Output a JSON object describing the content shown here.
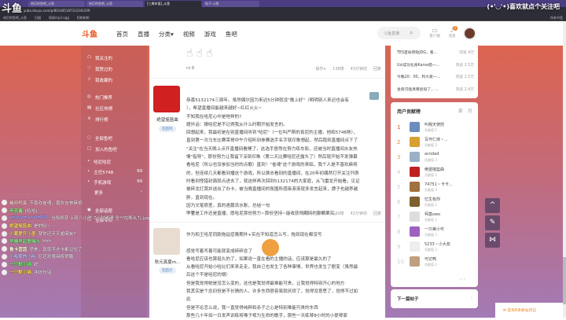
{
  "overlay": {
    "logo": "斗鱼",
    "follow": "(•'◡'•)喜欢就点个关注吧"
  },
  "browser": {
    "tabs": [
      "哈尼的鱼吧_斗鱼",
      "哈尼的鱼吧_斗鱼",
      "[三周年饭]_斗鱼",
      "帖子-斗鱼"
    ],
    "url": "yuba.douyu.com/p/801485187312341209",
    "bookmarks": [
      "哈尼的鱼吧_斗鱼",
      "扫描",
      "网易mp3 ogg",
      "阿帕帕帕"
    ],
    "bookmark_right": "所有书签"
  },
  "header": {
    "brand": "斗鱼",
    "nav": [
      "首页",
      "直播",
      "分类▾",
      "视频",
      "游戏",
      "鱼吧"
    ],
    "search_placeholder": "斗鱼直播",
    "client": "客户端",
    "messages": "消息",
    "message_count": "1",
    "icon_client": "client-icon",
    "icon_message": "bell-icon"
  },
  "sidebar": {
    "items": [
      {
        "label": "我关注的",
        "icon": "☖"
      },
      {
        "label": "我赞过的",
        "icon": "♡"
      },
      {
        "label": "我收藏的",
        "icon": "☆"
      },
      {
        "label": "热门推荐",
        "icon": "◎"
      },
      {
        "label": "社区热榜",
        "icon": "▤"
      },
      {
        "label": "排行榜",
        "icon": "♕"
      },
      {
        "label": "全部鱼吧",
        "icon": "◌"
      },
      {
        "label": "加入的鱼吧",
        "icon": "▢"
      }
    ],
    "groups": [
      {
        "label": "哈尼哈尼",
        "count": ""
      },
      {
        "label": "主任5748",
        "count": "99"
      },
      {
        "label": "手机游戏",
        "count": "99"
      }
    ],
    "more": "更多",
    "extra": [
      {
        "label": "全部话题",
        "icon": "◉"
      },
      {
        "label": "全部专栏",
        "icon": "▢"
      }
    ]
  },
  "posts": [
    {
      "likes": "0",
      "actions": "操作∨",
      "floor": "138楼",
      "time": "43分钟前",
      "reply": "回复"
    },
    {
      "name": "绝望摇篮曲",
      "badge": "犯困鸡",
      "lines": [
        "恭喜5132174三周年。虽然偶尔因为来迟5分钟就没\"晚上好\"（明明别人来迟也会有",
        "），希望直播间能越来越好~红红火火~",
        "不知我在哈尼心中是啥样的?",
        "题外话：猜哈尼是不记得我从什么时期开始发言的。",
        "回想起来，我最初是在别直播间听到\"哈尼\"（一位叫严斯的肯尼的主播，他和5748熟），",
        "直到第一次马车比赛荣哥中午介绍听到参赛选手名字就印象想起，然后跑到直播间点下了",
        "\"关注\"在当天晚上点开直播间看睡了，这选手居然在努力练车影，还被当时直播间水友热",
        "情\"指导\"，那份努力让我留下深刻印象（第二天比赛哈尼还露头了）然后就开始不发弹幕",
        "看哈尼（所以也没参加当时的点歌）直到！\"雀魂\"这个游戏的来临，我个人是不喜欢麻将",
        "的，但连续几天都看到播这个游戏，所以换去看别的直播间，在20年初偶然打开关注列表",
        "时看到怪猎封面就点进去了，就这样再次回到5132174的大家庭，从飞雷龙开始看，见证",
        "被碎龙打哭并送出了办卡，被当晚直播间的氛围所感染渐渐就多发言起来，牌子也越养越",
        "胖，直到现在。",
        "因为文笔很差，真的遇篇流水账，总结一句",
        "不管是工作还是直播，愿哈尼那份努力~那份坚持~能收获所期待的那颗果实。"
      ],
      "likes": "0",
      "actions": "举报",
      "actions2": "操作∨",
      "floor": "139楼",
      "time": "42分钟前",
      "reply": "回复"
    },
    {
      "name": "秋元真夏m...",
      "badge": "犯困大",
      "lines": [
        "作为和王哈尼同款拖延症晚期外+实在不知道怎么写，拖到现在都没写",
        "",
        "感觉写着写着可能就变成碎碎念了",
        "看哈尼应该也算挺久的了，如果说一直在看的主播的话，应该算是最久的了",
        "从看哈尼开始小哈比们来来走走，我自己也发生了各种事情，世界也发生了剧变（虽然最",
        "后这个不是哈尼的锅）",
        "但是我觉得她是没怎么变的，这也是我觉得最难能可贵，让我觉得特别开心的地方",
        "我其实是个念旧但是不长情的人，许多东西很容易就厌烦了，觉得没意思了，觉得不过如",
        "此",
        "但是不论怎么说，我一直觉得纯粹和赤子之心是特别难能可贵的东西",
        "那些几十年如一日发声训练将嗓子视为生命的歌手，那些一天练琴8小时的小提琴家"
      ]
    }
  ],
  "right": {
    "hot": [
      {
        "title": "TES首局惨败JDG，看...",
        "views": "浏览 4万"
      },
      {
        "title": "Uzi成功化身Karsa猎一...",
        "views": "浏览 2.5万"
      },
      {
        "title": "今晚20：00，和大家一...",
        "views": "浏览 2.5万"
      },
      {
        "title": "金贡可能真要退役了，...",
        "views": "浏览 2.4万"
      }
    ],
    "board_title": "用户贡献榜",
    "board_tabs": [
      "周",
      "月"
    ],
    "board": [
      {
        "rank": "1",
        "name": "叫我天使煎",
        "score": "贡献值 5",
        "color": "#6a8cc0"
      },
      {
        "rank": "2",
        "name": "写作仁侠丶...",
        "score": "贡献值 3",
        "color": "#d8a030"
      },
      {
        "rank": "3",
        "name": "acndad",
        "score": "贡献值 3",
        "color": "#9ab0c8"
      },
      {
        "rank": "4",
        "name": "绝望摇篮曲",
        "score": "贡献值 3",
        "color": "#c02020"
      },
      {
        "rank": "5",
        "name": "74751丶卡卡...",
        "score": "贡献值 3",
        "color": "#a07040"
      },
      {
        "rank": "6",
        "name": "忆生有你",
        "score": "贡献值 3",
        "color": "#806030"
      },
      {
        "rank": "7",
        "name": "柯基owo",
        "score": "贡献值 3",
        "color": "#ddd"
      },
      {
        "rank": "8",
        "name": "一只美小可",
        "score": "贡献值 3",
        "color": "#a060c0"
      },
      {
        "rank": "9",
        "name": "5233丶小大叔",
        "score": "贡献值 3",
        "color": "#eee"
      },
      {
        "rank": "10",
        "name": "可达鸭",
        "score": "贡献值 3",
        "color": "#c0a080"
      }
    ],
    "pager": "‹ ›",
    "next_post": "下一篇帖子",
    "next_arrow": "›"
  },
  "float_buttons": [
    {
      "icon": "^",
      "name": "back-to-top"
    },
    {
      "icon": "✎",
      "name": "edit"
    },
    {
      "icon": "⋈",
      "name": "share"
    }
  ],
  "notice": "您有6条新站内信",
  "chat": [
    {
      "name": "羅時鸭蛋",
      "msg": "不喜欢雀魂，喜欢吉林麻将",
      "color": "#f0c0c0"
    },
    {
      "name": "辛苏酱",
      "msg": "[哈哈]",
      "color": "#8f8"
    },
    {
      "name": "enjoymyself050",
      "msg": "当场抓获 上班八小时 7小时雀魂 全**在断幺九.jpg",
      "color": "#aaf"
    },
    {
      "name": "绝望摇篮曲",
      "msg": "是的哈~",
      "color": "#fd6"
    },
    {
      "name": "小葛爱开小差",
      "msg": "就你还天天雀麻友?",
      "color": "#fd6"
    },
    {
      "name": "早睡早起爱喝水",
      "msg": "hhh",
      "color": "#8e8"
    },
    {
      "name": "鲁卡茵茵",
      "msg": "恐怖，真就不办卡都记住了",
      "color": "#ffd"
    },
    {
      "name": "小哈家的小哈",
      "msg": "尼还欢恩麻将很酷",
      "color": "#ccf"
    },
    {
      "name": "一只默小猫",
      "msg": "好",
      "color": "#6f6"
    },
    {
      "name": "一只默小猫",
      "msg": "冲这句话",
      "color": "#fd4"
    }
  ]
}
